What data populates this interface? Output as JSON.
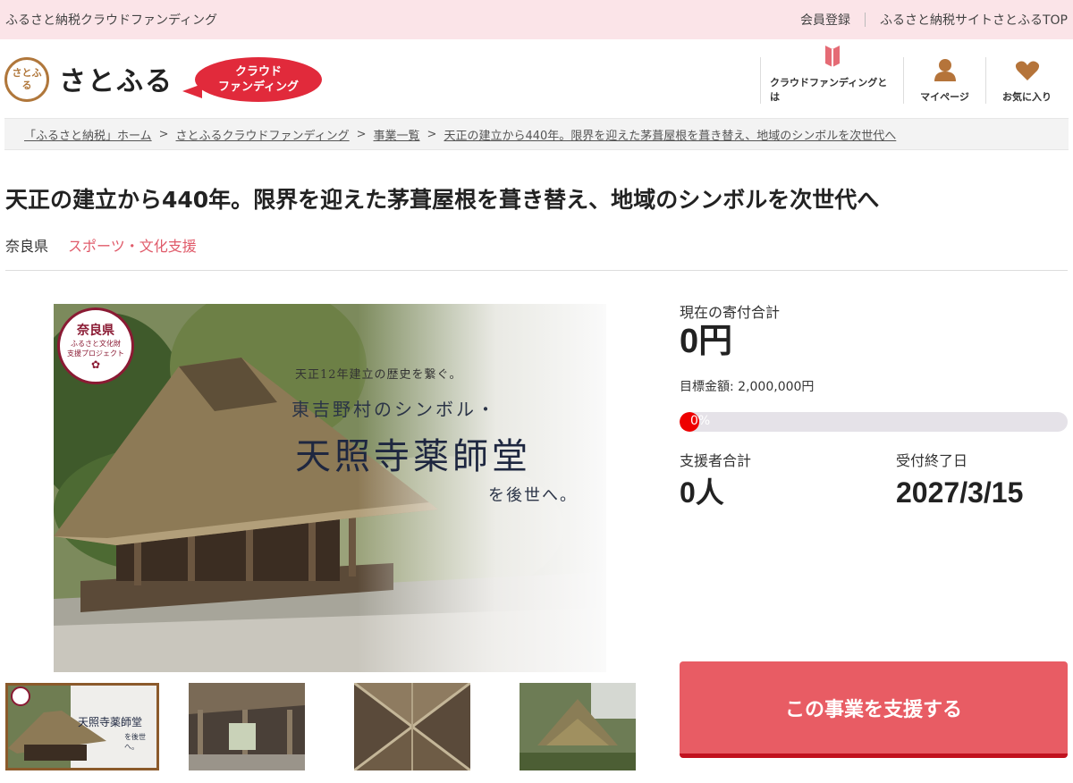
{
  "topbar": {
    "site_label": "ふるさと納税クラウドファンディング",
    "links": [
      "会員登録",
      "ふるさと納税サイトさとふるTOP"
    ]
  },
  "header": {
    "logo_mark": "さとふる",
    "logo_text": "さとふる",
    "badge_line1": "クラウド",
    "badge_line2": "ファンディング",
    "nav": [
      {
        "label": "クラウドファンディングとは",
        "icon": "book-icon"
      },
      {
        "label": "マイページ",
        "icon": "user-icon"
      },
      {
        "label": "お気に入り",
        "icon": "heart-icon"
      }
    ]
  },
  "breadcrumb": [
    "「ふるさと納税」ホーム",
    "さとふるクラウドファンディング",
    "事業一覧",
    "天正の建立から440年。限界を迎えた茅葺屋根を葺き替え、地域のシンボルを次世代へ"
  ],
  "project": {
    "title": "天正の建立から440年。限界を迎えた茅葺屋根を葺き替え、地域のシンボルを次世代へ",
    "prefecture": "奈良県",
    "category": "スポーツ・文化支援"
  },
  "main_image": {
    "seal_title": "奈良県",
    "seal_sub1": "ふるさと文化財",
    "seal_sub2": "支援プロジェクト",
    "sub": "天正12年建立の歴史を繋ぐ。",
    "line1": "東吉野村のシンボル・",
    "line2": "天照寺薬師堂",
    "line3": "を後世へ。"
  },
  "thumb_main": {
    "line1": "天照寺薬師堂",
    "line2": "を後世へ。"
  },
  "stats": {
    "total_label": "現在の寄付合計",
    "total_value": "0円",
    "target_text": "目標金額: 2,000,000円",
    "progress_text": "0%",
    "progress_fraction": 0.0,
    "supporters_label": "支援者合計",
    "supporters_value": "0人",
    "end_label": "受付終了日",
    "end_value": "2027/3/15"
  },
  "support_button": "この事業を支援する",
  "colors": {
    "accent": "#e85c64",
    "topbar_bg": "#fbe4e8",
    "category": "#e05b6a",
    "badge": "#e12a3b"
  }
}
